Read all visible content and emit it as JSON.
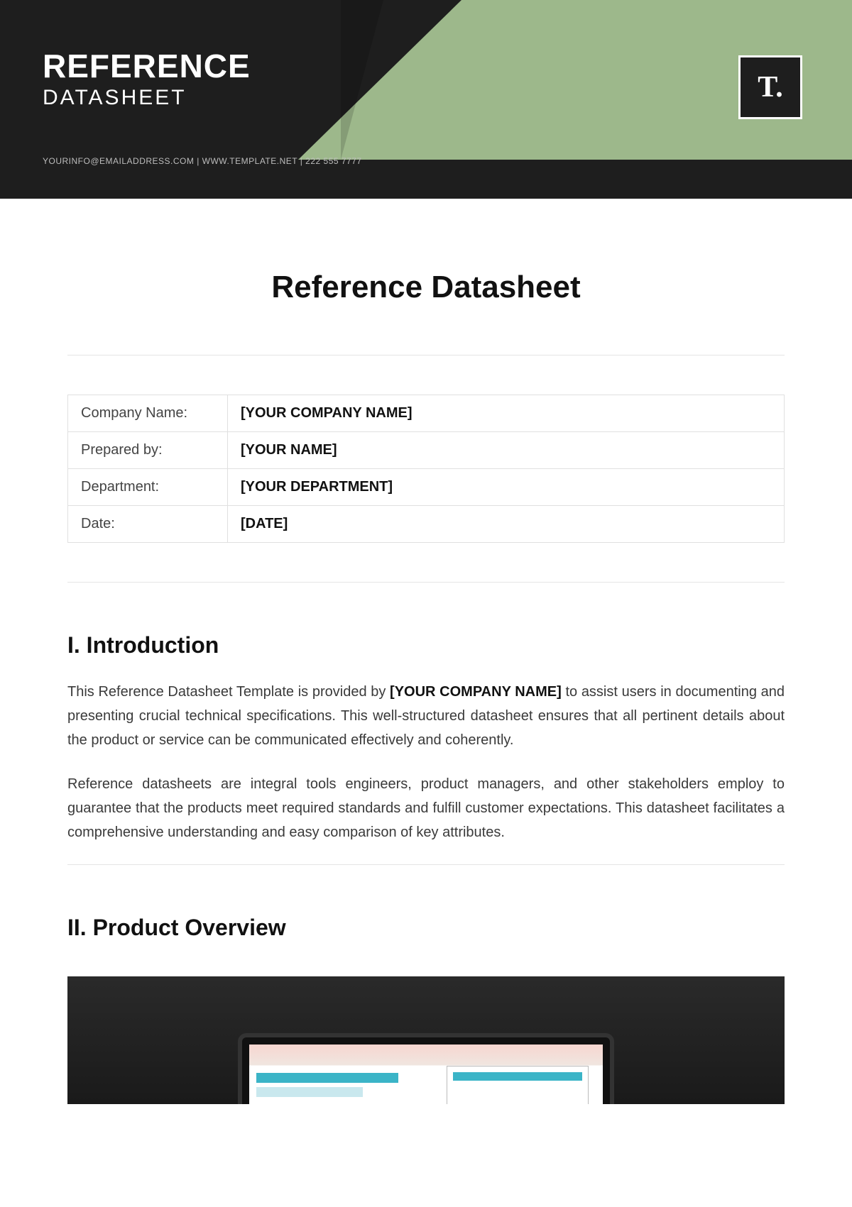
{
  "banner": {
    "title_line1": "REFERENCE",
    "title_line2": "DATASHEET",
    "contact": "YOURINFO@EMAILADDRESS.COM | WWW.TEMPLATE.NET | 222 555 7777",
    "logo_text": "T."
  },
  "doc": {
    "title": "Reference Datasheet"
  },
  "info_rows": [
    {
      "label": "Company Name:",
      "value": "[YOUR COMPANY NAME]"
    },
    {
      "label": "Prepared by:",
      "value": "[YOUR NAME]"
    },
    {
      "label": "Department:",
      "value": "[YOUR DEPARTMENT]"
    },
    {
      "label": "Date:",
      "value": "[DATE]"
    }
  ],
  "sections": {
    "intro_head": "I. Introduction",
    "intro_p1_a": "This Reference Datasheet Template is provided by ",
    "intro_p1_bold": "[YOUR COMPANY NAME]",
    "intro_p1_b": " to assist users in documenting and presenting crucial technical specifications. This well-structured datasheet ensures that all pertinent details about the product or service can be communicated effectively and coherently.",
    "intro_p2": "Reference datasheets are integral tools engineers, product managers, and other stakeholders employ to guarantee that the products meet required standards and fulfill customer expectations. This datasheet facilitates a comprehensive understanding and easy comparison of key attributes.",
    "overview_head": "II. Product Overview"
  }
}
